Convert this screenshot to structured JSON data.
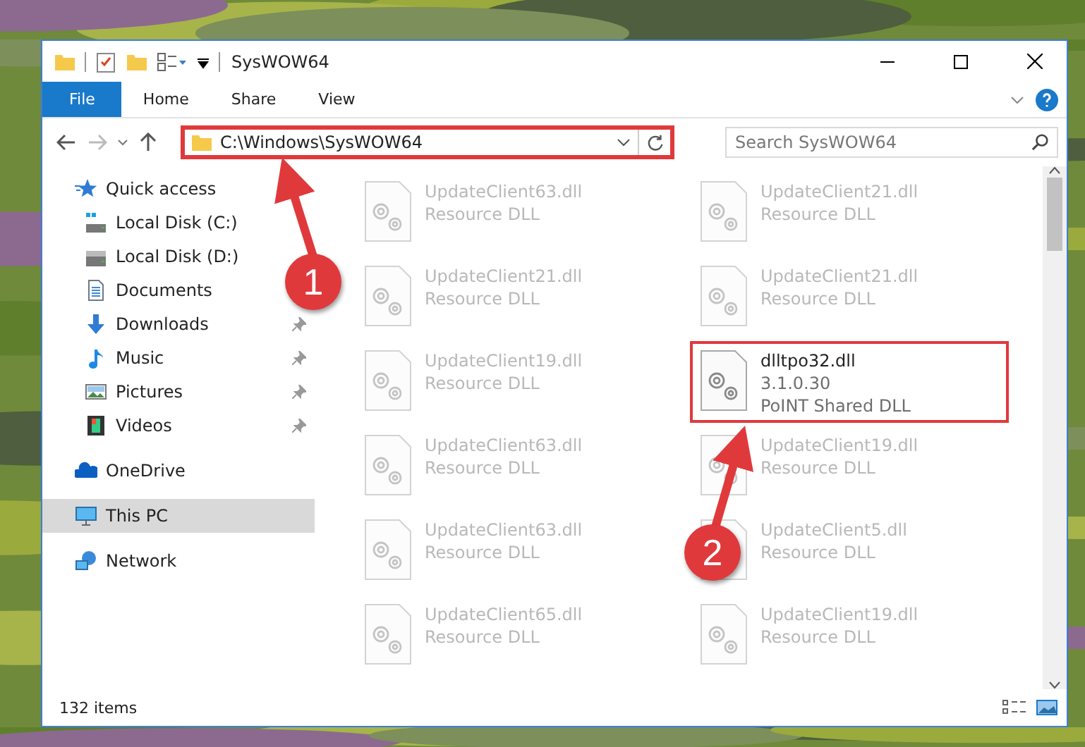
{
  "window": {
    "title": "SysWOW64",
    "ribbon_tabs": [
      {
        "label": "File",
        "selected": true
      },
      {
        "label": "Home",
        "selected": false
      },
      {
        "label": "Share",
        "selected": false
      },
      {
        "label": "View",
        "selected": false
      }
    ]
  },
  "address_bar": {
    "path": "C:\\Windows\\SysWOW64",
    "highlighted": true
  },
  "search": {
    "placeholder": "Search SysWOW64"
  },
  "sidebar": {
    "items": [
      {
        "label": "Quick access",
        "selected": false,
        "children": [
          {
            "label": "Local Disk (C:)",
            "selected": false
          },
          {
            "label": "Local Disk (D:)",
            "selected": false
          },
          {
            "label": "Documents",
            "selected": false
          },
          {
            "label": "Downloads",
            "pinned": true,
            "selected": false
          },
          {
            "label": "Music",
            "pinned": true,
            "selected": false
          },
          {
            "label": "Pictures",
            "pinned": true,
            "selected": false
          },
          {
            "label": "Videos",
            "pinned": true,
            "selected": false
          }
        ]
      },
      {
        "label": "OneDrive",
        "selected": false
      },
      {
        "label": "This PC",
        "selected": true
      },
      {
        "label": "Network",
        "selected": false
      }
    ]
  },
  "files": [
    {
      "name": "UpdateClient63.dll",
      "lines": [
        "Resource DLL"
      ],
      "blurred": true,
      "highlighted": false
    },
    {
      "name": "UpdateClient21.dll",
      "lines": [
        "Resource DLL"
      ],
      "blurred": true,
      "highlighted": false
    },
    {
      "name": "UpdateClient21.dll",
      "lines": [
        "Resource DLL"
      ],
      "blurred": true,
      "highlighted": false
    },
    {
      "name": "UpdateClient21.dll",
      "lines": [
        "Resource DLL"
      ],
      "blurred": true,
      "highlighted": false
    },
    {
      "name": "UpdateClient19.dll",
      "lines": [
        "Resource DLL"
      ],
      "blurred": true,
      "highlighted": false
    },
    {
      "name": "dlltpo32.dll",
      "lines": [
        "3.1.0.30",
        "PoINT Shared DLL"
      ],
      "blurred": false,
      "highlighted": true
    },
    {
      "name": "UpdateClient63.dll",
      "lines": [
        "Resource DLL"
      ],
      "blurred": true,
      "highlighted": false
    },
    {
      "name": "UpdateClient19.dll",
      "lines": [
        "Resource DLL"
      ],
      "blurred": true,
      "highlighted": false
    },
    {
      "name": "UpdateClient63.dll",
      "lines": [
        "Resource DLL"
      ],
      "blurred": true,
      "highlighted": false
    },
    {
      "name": "UpdateClient5.dll",
      "lines": [
        "Resource DLL"
      ],
      "blurred": true,
      "highlighted": false
    },
    {
      "name": "UpdateClient65.dll",
      "lines": [
        "Resource DLL"
      ],
      "blurred": true,
      "highlighted": false
    },
    {
      "name": "UpdateClient19.dll",
      "lines": [
        "Resource DLL"
      ],
      "blurred": true,
      "highlighted": false
    }
  ],
  "status_bar": {
    "item_count": "132 items"
  },
  "callouts": [
    {
      "label": "1"
    },
    {
      "label": "2"
    }
  ]
}
